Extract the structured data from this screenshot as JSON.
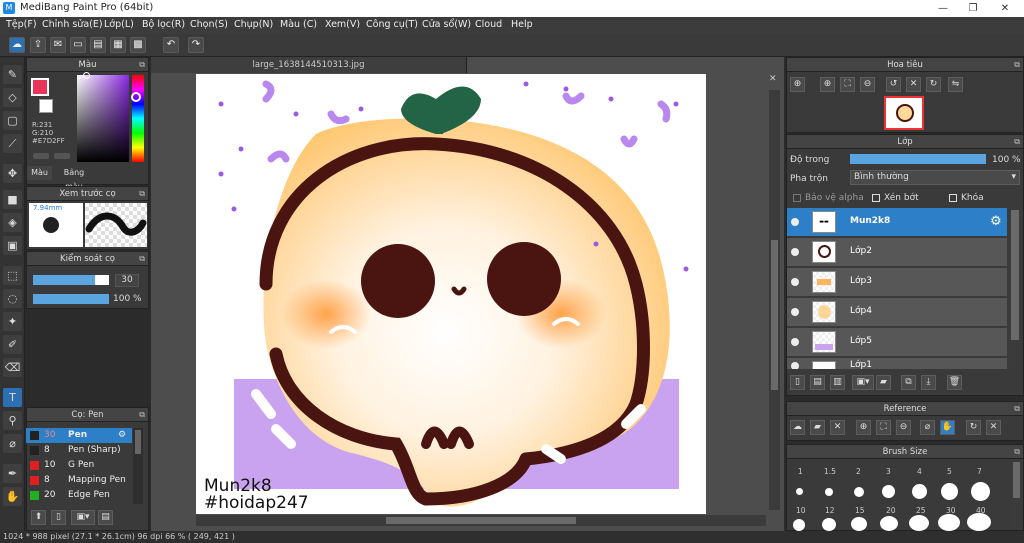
{
  "window": {
    "title": "MediBang Paint Pro (64bit)",
    "min": "—",
    "max": "❐",
    "close": "✕"
  },
  "menu": [
    "Tệp(F)",
    "Chỉnh sửa(E)",
    "Lớp(L)",
    "Bộ lọc(R)",
    "Chọn(S)",
    "Chụp(N)",
    "Màu (C)",
    "Xem(V)",
    "Công cụ(T)",
    "Cửa sổ(W)",
    "Cloud",
    "Help"
  ],
  "toolbar": {
    "undo": "↶",
    "redo": "↷"
  },
  "color_panel": {
    "title": "Màu",
    "r": "R:231",
    "g": "G:210",
    "b": "B:255",
    "hex": "#E7D2FF",
    "tab_color": "Màu",
    "tab_palette": "Bảng màu",
    "fg": "#e8365a",
    "bg": "#ffffff"
  },
  "brush_preview": {
    "title": "Xem trước cọ",
    "size": "7.94mm"
  },
  "brush_control": {
    "title": "Kiểm soát cọ",
    "size": "30",
    "opacity": "100 %",
    "size_fill": 0.82,
    "opacity_fill": 1.0
  },
  "brush_list": {
    "title": "Cọ: Pen",
    "items": [
      {
        "size": "30",
        "name": "Pen",
        "color": "#222222",
        "selected": true
      },
      {
        "size": "8",
        "name": "Pen (Sharp)",
        "color": "#222222",
        "selected": false
      },
      {
        "size": "10",
        "name": "G Pen",
        "color": "#e02020",
        "selected": false
      },
      {
        "size": "8",
        "name": "Mapping Pen",
        "color": "#e02020",
        "selected": false
      },
      {
        "size": "20",
        "name": "Edge Pen",
        "color": "#20b020",
        "selected": false
      }
    ]
  },
  "document": {
    "tab": "large_1638144510313.jpg",
    "text1": "Mun2k8",
    "text2": "#hoidap247"
  },
  "navigator": {
    "title": "Hoa tiêu"
  },
  "layers": {
    "title": "Lớp",
    "opacity_label": "Độ trong",
    "opacity_value": "100 %",
    "opacity_fill": 1.0,
    "blend_label": "Pha trộn",
    "blend_value": "Bình thường",
    "protect_alpha": "Bảo vệ alpha",
    "clip": "Xén bớt",
    "lock": "Khóa",
    "items": [
      {
        "name": "Mun2k8",
        "selected": true
      },
      {
        "name": "Lớp2",
        "selected": false
      },
      {
        "name": "Lớp3",
        "selected": false
      },
      {
        "name": "Lớp4",
        "selected": false
      },
      {
        "name": "Lớp5",
        "selected": false
      },
      {
        "name": "Lớp1",
        "selected": false
      }
    ]
  },
  "reference": {
    "title": "Reference"
  },
  "brush_size": {
    "title": "Brush Size",
    "row1": [
      "1",
      "1.5",
      "2",
      "3",
      "4",
      "5",
      "7"
    ],
    "row2": [
      "10",
      "12",
      "15",
      "20",
      "25",
      "30",
      "40"
    ]
  },
  "status": {
    "text": "1024 * 988 pixel   (27.1 * 26.1cm)  96 dpi   66 %   ( 249, 421 )"
  }
}
